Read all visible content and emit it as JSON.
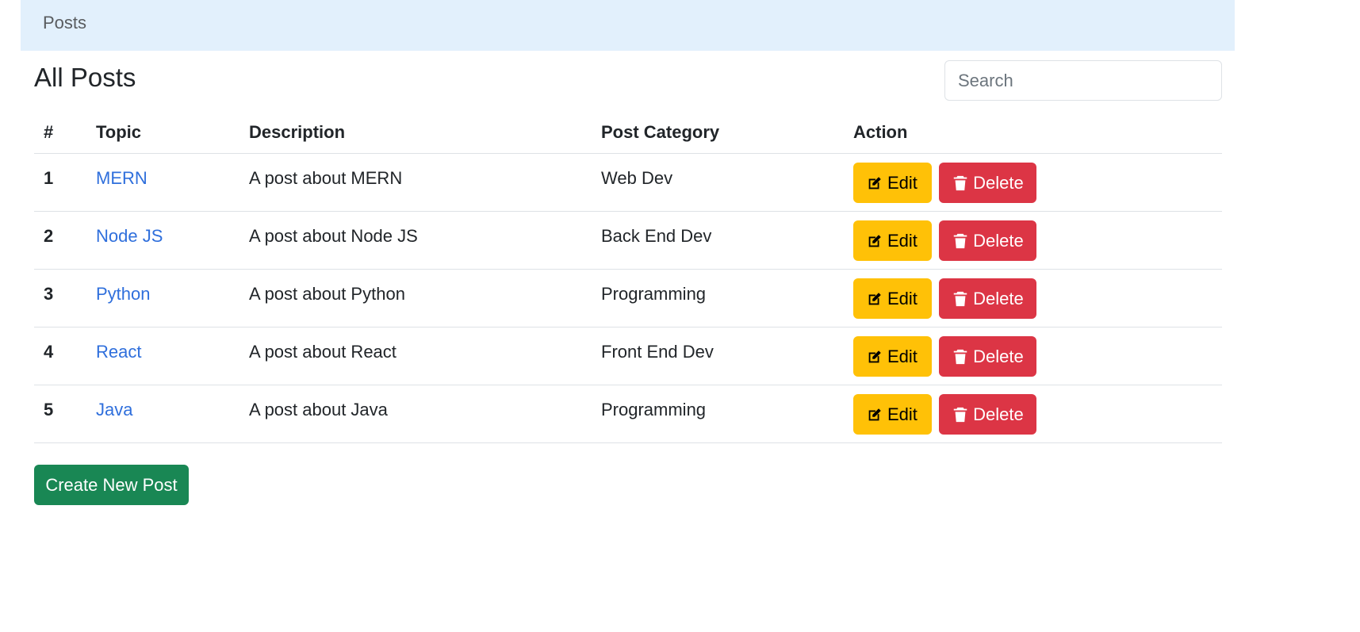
{
  "navbar": {
    "brand": "Posts",
    "background": "#e2f0fc"
  },
  "page": {
    "title": "All Posts"
  },
  "search": {
    "placeholder": "Search",
    "value": ""
  },
  "table": {
    "headers": {
      "num": "#",
      "topic": "Topic",
      "description": "Description",
      "category": "Post Category",
      "action": "Action"
    },
    "rows": [
      {
        "num": "1",
        "topic": "MERN",
        "description": "A post about MERN",
        "category": "Web Dev"
      },
      {
        "num": "2",
        "topic": "Node JS",
        "description": "A post about Node JS",
        "category": "Back End Dev"
      },
      {
        "num": "3",
        "topic": "Python",
        "description": "A post about Python",
        "category": "Programming"
      },
      {
        "num": "4",
        "topic": "React",
        "description": "A post about React",
        "category": "Front End Dev"
      },
      {
        "num": "5",
        "topic": "Java",
        "description": "A post about Java",
        "category": "Programming"
      }
    ]
  },
  "actions": {
    "edit_label": "Edit",
    "edit_icon": "edit-icon",
    "delete_label": "Delete",
    "delete_icon": "trash-icon"
  },
  "create_button": {
    "label": "Create New Post"
  },
  "colors": {
    "link": "#2f6fdc",
    "edit": "#ffc107",
    "delete": "#dc3545",
    "create": "#198754"
  }
}
